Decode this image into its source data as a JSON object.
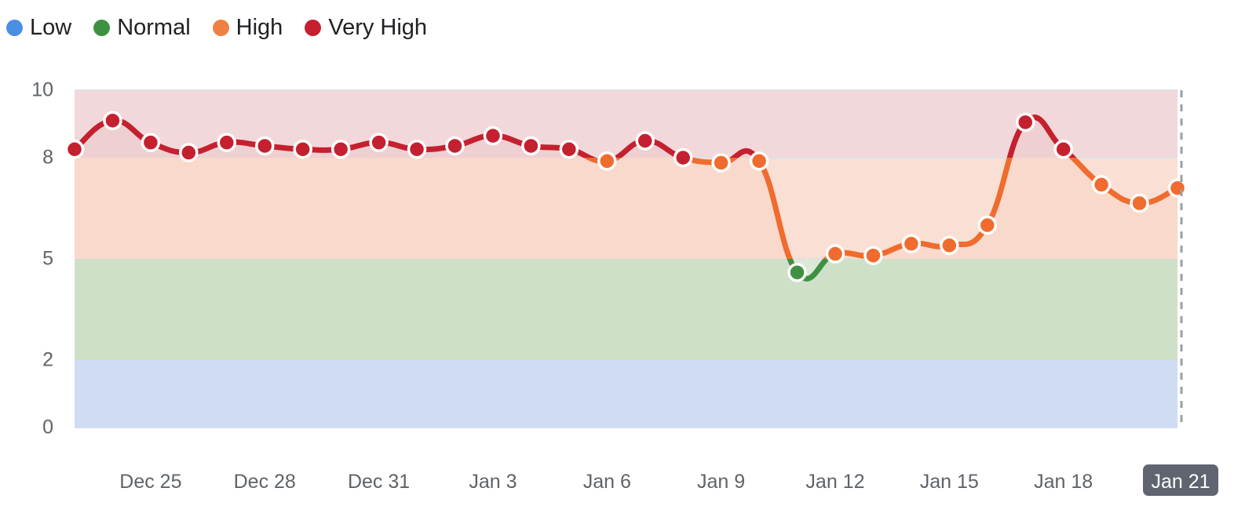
{
  "legend": {
    "items": [
      {
        "label": "Low",
        "color": "#4a90e2"
      },
      {
        "label": "Normal",
        "color": "#3f9142"
      },
      {
        "label": "High",
        "color": "#ef8043"
      },
      {
        "label": "Very High",
        "color": "#c4202f"
      }
    ]
  },
  "chart_data": {
    "type": "area",
    "title": "",
    "xlabel": "",
    "ylabel": "",
    "ylim": [
      0,
      10
    ],
    "yticks": [
      0,
      2,
      5,
      8,
      10
    ],
    "grid": true,
    "legend_position": "top-left",
    "x": [
      "Dec 23",
      "Dec 24",
      "Dec 25",
      "Dec 26",
      "Dec 27",
      "Dec 28",
      "Dec 29",
      "Dec 30",
      "Dec 31",
      "Jan 1",
      "Jan 2",
      "Jan 3",
      "Jan 4",
      "Jan 5",
      "Jan 6",
      "Jan 7",
      "Jan 8",
      "Jan 9",
      "Jan 10",
      "Jan 11",
      "Jan 12",
      "Jan 13",
      "Jan 14",
      "Jan 15",
      "Jan 16",
      "Jan 17",
      "Jan 18",
      "Jan 19",
      "Jan 20",
      "Jan 21"
    ],
    "xtick_labels": [
      "Dec 25",
      "Dec 28",
      "Dec 31",
      "Jan 3",
      "Jan 6",
      "Jan 9",
      "Jan 12",
      "Jan 15",
      "Jan 18",
      "Jan 21"
    ],
    "xtick_highlighted": "Jan 21",
    "values": [
      8.25,
      9.1,
      8.45,
      8.15,
      8.45,
      8.35,
      8.25,
      8.25,
      8.45,
      8.25,
      8.35,
      8.65,
      8.35,
      8.25,
      7.9,
      8.5,
      8.0,
      7.85,
      7.9,
      4.6,
      5.15,
      5.1,
      5.45,
      5.4,
      6.0,
      9.05,
      8.25,
      7.2,
      6.65,
      7.1
    ],
    "bands": [
      {
        "name": "Low",
        "from": 0,
        "to": 2,
        "fill": "#d7e3f9",
        "line": "#4a90e2"
      },
      {
        "name": "Normal",
        "from": 2,
        "to": 5,
        "fill": "#dbe9d6",
        "line": "#3f9142"
      },
      {
        "name": "High",
        "from": 5,
        "to": 8,
        "fill": "#fadfd4",
        "line": "#ef6c2e"
      },
      {
        "name": "Very High",
        "from": 8,
        "to": 10,
        "fill": "#f2d8da",
        "line": "#c4202f"
      }
    ],
    "marker_ring_color": "#ffffff",
    "gridline_color": "#dfe1e5",
    "axis_marker_color": "#9aa0a6",
    "xtick_badge_color": "#5f6470"
  }
}
